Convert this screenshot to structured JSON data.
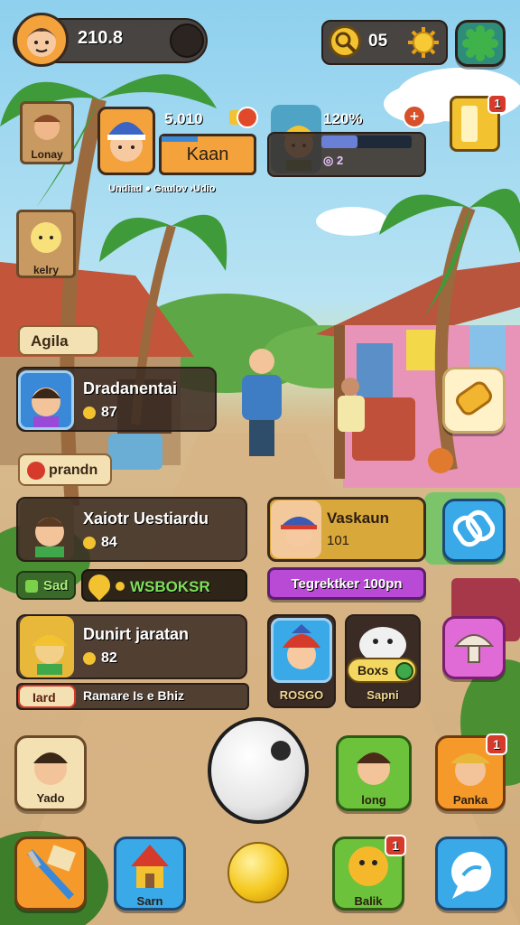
{
  "player": {
    "score": "210.8"
  },
  "top_right": {
    "key_count": "05",
    "notification_badge": "1"
  },
  "friend_cards": [
    {
      "name": "Kaan",
      "value": "5.010",
      "footer": "Undiad ● Gaulov ›Udio"
    },
    {
      "name": "",
      "value": "120%",
      "footer": "◎ 2"
    }
  ],
  "left_signs": [
    {
      "label": "Lonay"
    },
    {
      "label": "kelry"
    }
  ],
  "tag_agila": "Agila",
  "tag_prandn": "prandn",
  "list_rows": [
    {
      "name": "Dradanentai",
      "value": "87"
    },
    {
      "name": "Xaiotr Uestiardu",
      "value": "84"
    },
    {
      "name": "Dunirt jaratan",
      "value": "82"
    }
  ],
  "mid_chips": {
    "left": "Sad",
    "right": "WSBOKSR"
  },
  "right_card": {
    "name": "Vaskaun",
    "value": "101"
  },
  "purple_button": "Tegrektker 100pn",
  "bottom_bar": {
    "tag": "Iard",
    "text": "Ramare Is e Bhiz"
  },
  "small_cards": [
    {
      "label": "ROSGO"
    },
    {
      "label": "Sapni",
      "badge": "Boxs"
    }
  ],
  "bottom_row1": [
    {
      "label": "Yado"
    },
    {
      "label": "long"
    },
    {
      "label": "Panka",
      "badge": "1"
    }
  ],
  "bottom_row2": [
    {
      "label": ""
    },
    {
      "label": "Sarn"
    },
    {
      "label": ""
    },
    {
      "label": "Balik",
      "badge": "1"
    },
    {
      "label": ""
    }
  ],
  "colors": {
    "panel": "#3a2c24",
    "orange_card": "#f3a23c",
    "green_button": "#6cc23a",
    "blue_button": "#3aa9e8",
    "orange_button": "#f59a2a",
    "purple_button": "#b84ad6",
    "gold": "#f2c230"
  }
}
